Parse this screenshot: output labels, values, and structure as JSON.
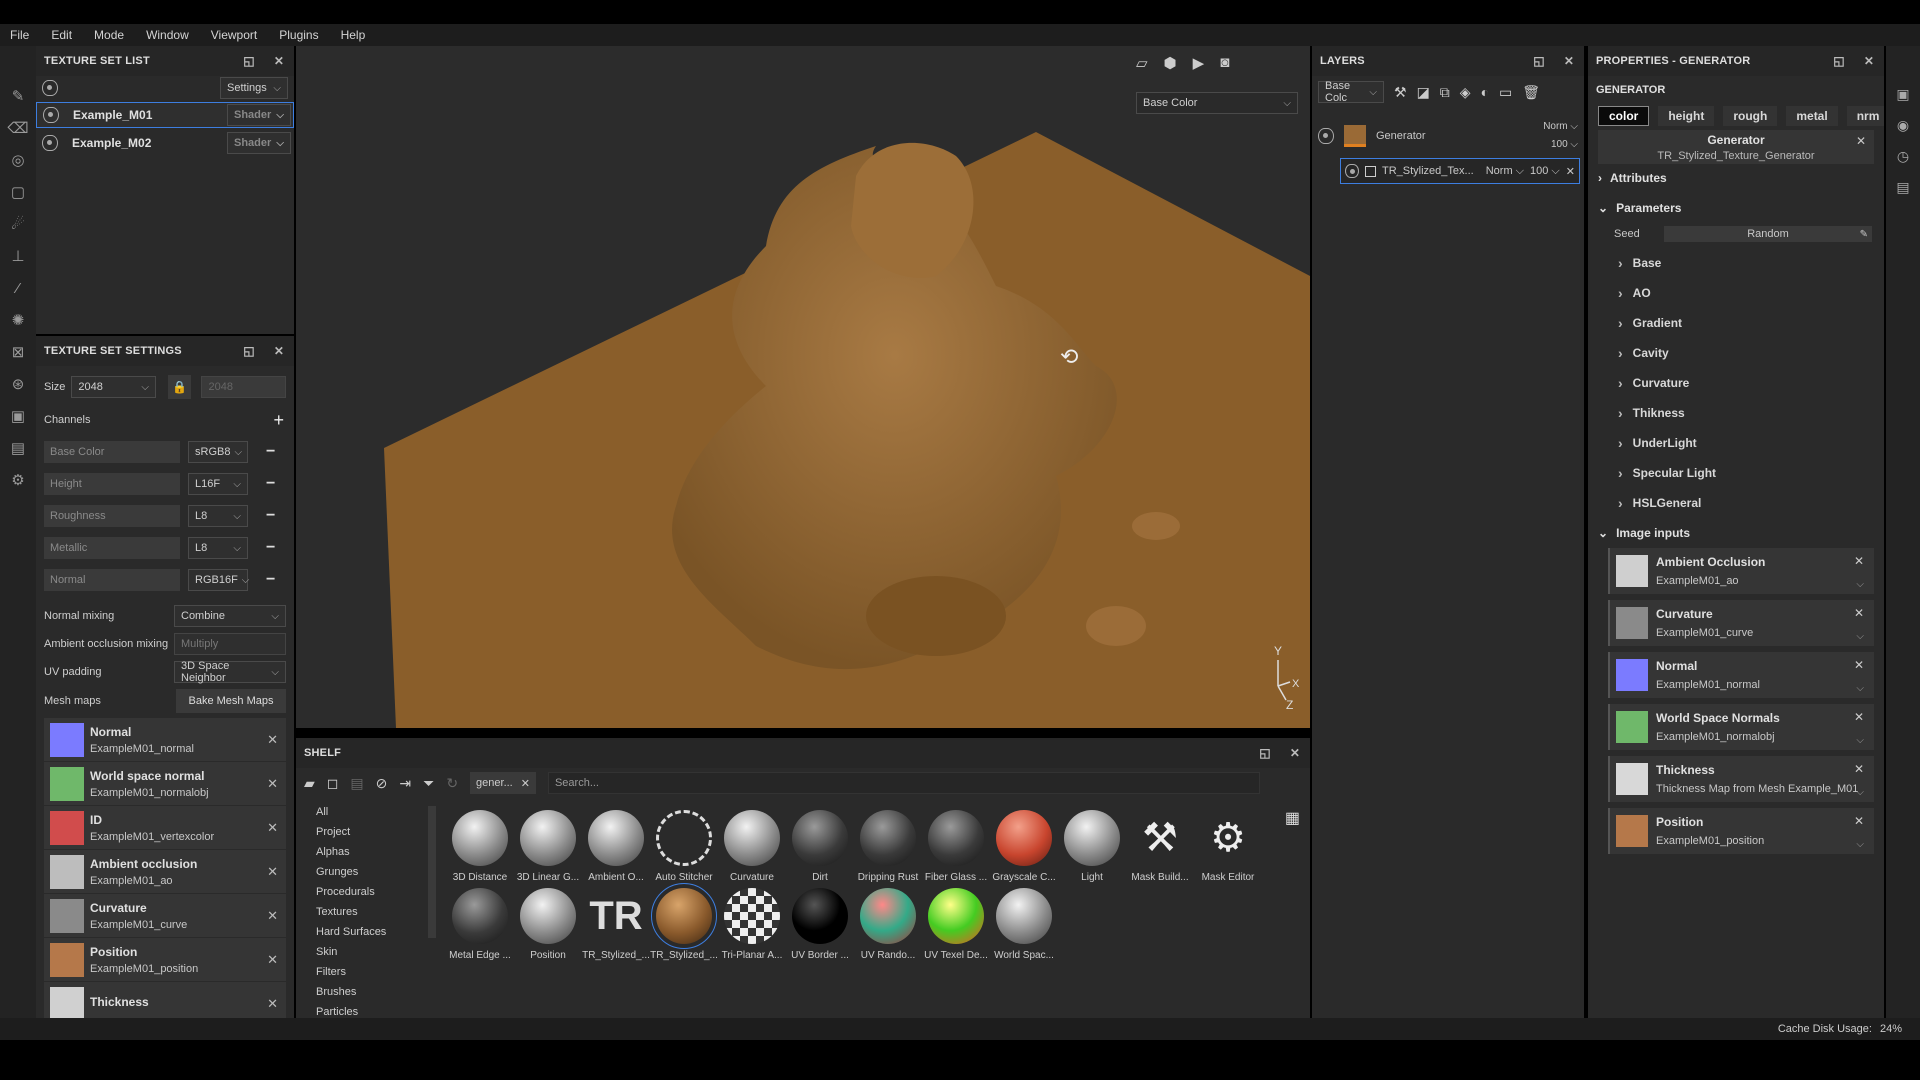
{
  "menu": [
    "File",
    "Edit",
    "Mode",
    "Window",
    "Viewport",
    "Plugins",
    "Help"
  ],
  "texture_set_list": {
    "title": "TEXTURE SET LIST",
    "settings_label": "Settings",
    "items": [
      {
        "name": "Example_M01",
        "shader": "Shader"
      },
      {
        "name": "Example_M02",
        "shader": "Shader"
      }
    ]
  },
  "texture_set_settings": {
    "title": "TEXTURE SET SETTINGS",
    "size_label": "Size",
    "size_value": "2048",
    "size_locked_value": "2048",
    "channels_label": "Channels",
    "channels": [
      {
        "name": "Base Color",
        "format": "sRGB8"
      },
      {
        "name": "Height",
        "format": "L16F"
      },
      {
        "name": "Roughness",
        "format": "L8"
      },
      {
        "name": "Metallic",
        "format": "L8"
      },
      {
        "name": "Normal",
        "format": "RGB16F"
      }
    ],
    "normal_mixing_label": "Normal mixing",
    "normal_mixing_value": "Combine",
    "ao_mixing_label": "Ambient occlusion mixing",
    "ao_mixing_value": "Multiply",
    "uv_padding_label": "UV padding",
    "uv_padding_value": "3D Space Neighbor",
    "mesh_maps_label": "Mesh maps",
    "bake_button": "Bake Mesh Maps",
    "mesh_maps": [
      {
        "title": "Normal",
        "file": "ExampleM01_normal",
        "color": "#7b7bff"
      },
      {
        "title": "World space normal",
        "file": "ExampleM01_normalobj",
        "color": "#6fb86a"
      },
      {
        "title": "ID",
        "file": "ExampleM01_vertexcolor",
        "color": "#d14c4c"
      },
      {
        "title": "Ambient occlusion",
        "file": "ExampleM01_ao",
        "color": "#bdbdbd"
      },
      {
        "title": "Curvature",
        "file": "ExampleM01_curve",
        "color": "#8a8a8a"
      },
      {
        "title": "Position",
        "file": "ExampleM01_position",
        "color": "#b5784a"
      },
      {
        "title": "Thickness",
        "file": "",
        "color": "#d0d0d0"
      }
    ]
  },
  "viewport": {
    "channel_dropdown": "Base Color",
    "axis_y": "Y",
    "axis_x": "X",
    "axis_z": "Z"
  },
  "shelf": {
    "title": "SHELF",
    "filter_tag": "gener...",
    "search_placeholder": "Search...",
    "categories": [
      "All",
      "Project",
      "Alphas",
      "Grunges",
      "Procedurals",
      "Textures",
      "Hard Surfaces",
      "Skin",
      "Filters",
      "Brushes",
      "Particles"
    ],
    "row1": [
      {
        "name": "3D Distance",
        "style": "grey"
      },
      {
        "name": "3D Linear G...",
        "style": "grey"
      },
      {
        "name": "Ambient O...",
        "style": "grey"
      },
      {
        "name": "Auto Stitcher",
        "style": "dashed"
      },
      {
        "name": "Curvature",
        "style": "grey"
      },
      {
        "name": "Dirt",
        "style": "dark"
      },
      {
        "name": "Dripping Rust",
        "style": "dark"
      },
      {
        "name": "Fiber Glass ...",
        "style": "dark"
      },
      {
        "name": "Grayscale C...",
        "style": "red"
      },
      {
        "name": "Light",
        "style": "grey"
      },
      {
        "name": "Mask Build...",
        "style": "tool"
      },
      {
        "name": "Mask Editor",
        "style": "tool2"
      }
    ],
    "row2": [
      {
        "name": "Metal Edge ...",
        "style": "dark"
      },
      {
        "name": "Position",
        "style": "grey"
      },
      {
        "name": "TR_Stylized_...",
        "style": "tr"
      },
      {
        "name": "TR_Stylized_...",
        "style": "brown"
      },
      {
        "name": "Tri-Planar A...",
        "style": "checker"
      },
      {
        "name": "UV Border ...",
        "style": "black"
      },
      {
        "name": "UV Rando...",
        "style": "rainbow"
      },
      {
        "name": "UV Texel De...",
        "style": "green"
      },
      {
        "name": "World Spac...",
        "style": "grey"
      }
    ]
  },
  "layers": {
    "title": "LAYERS",
    "channel": "Base Colc",
    "generator_name": "Generator",
    "generator_blend": "Norm",
    "generator_opacity": "100",
    "sub_name": "TR_Stylized_Tex...",
    "sub_blend": "Norm",
    "sub_opacity": "100"
  },
  "properties": {
    "title": "PROPERTIES - GENERATOR",
    "section": "GENERATOR",
    "tabs": [
      "color",
      "height",
      "rough",
      "metal",
      "nrm"
    ],
    "gen_label": "Generator",
    "gen_value": "TR_Stylized_Texture_Generator",
    "attributes": "Attributes",
    "parameters": "Parameters",
    "seed_label": "Seed",
    "seed_value": "Random",
    "groups": [
      "Base",
      "AO",
      "Gradient",
      "Cavity",
      "Curvature",
      "Thikness",
      "UnderLight",
      "Specular Light",
      "HSLGeneral"
    ],
    "image_inputs": "Image inputs",
    "inputs": [
      {
        "title": "Ambient Occlusion",
        "file": "ExampleM01_ao",
        "color": "#cfcfcf"
      },
      {
        "title": "Curvature",
        "file": "ExampleM01_curve",
        "color": "#8a8a8a"
      },
      {
        "title": "Normal",
        "file": "ExampleM01_normal",
        "color": "#7b7bff"
      },
      {
        "title": "World Space Normals",
        "file": "ExampleM01_normalobj",
        "color": "#6fb86a"
      },
      {
        "title": "Thickness",
        "file": "Thickness Map from Mesh Example_M01",
        "color": "#d8d8d8"
      },
      {
        "title": "Position",
        "file": "ExampleM01_position",
        "color": "#b5784a"
      }
    ]
  },
  "status": {
    "cache_label": "Cache Disk Usage:",
    "cache_value": "24%"
  }
}
